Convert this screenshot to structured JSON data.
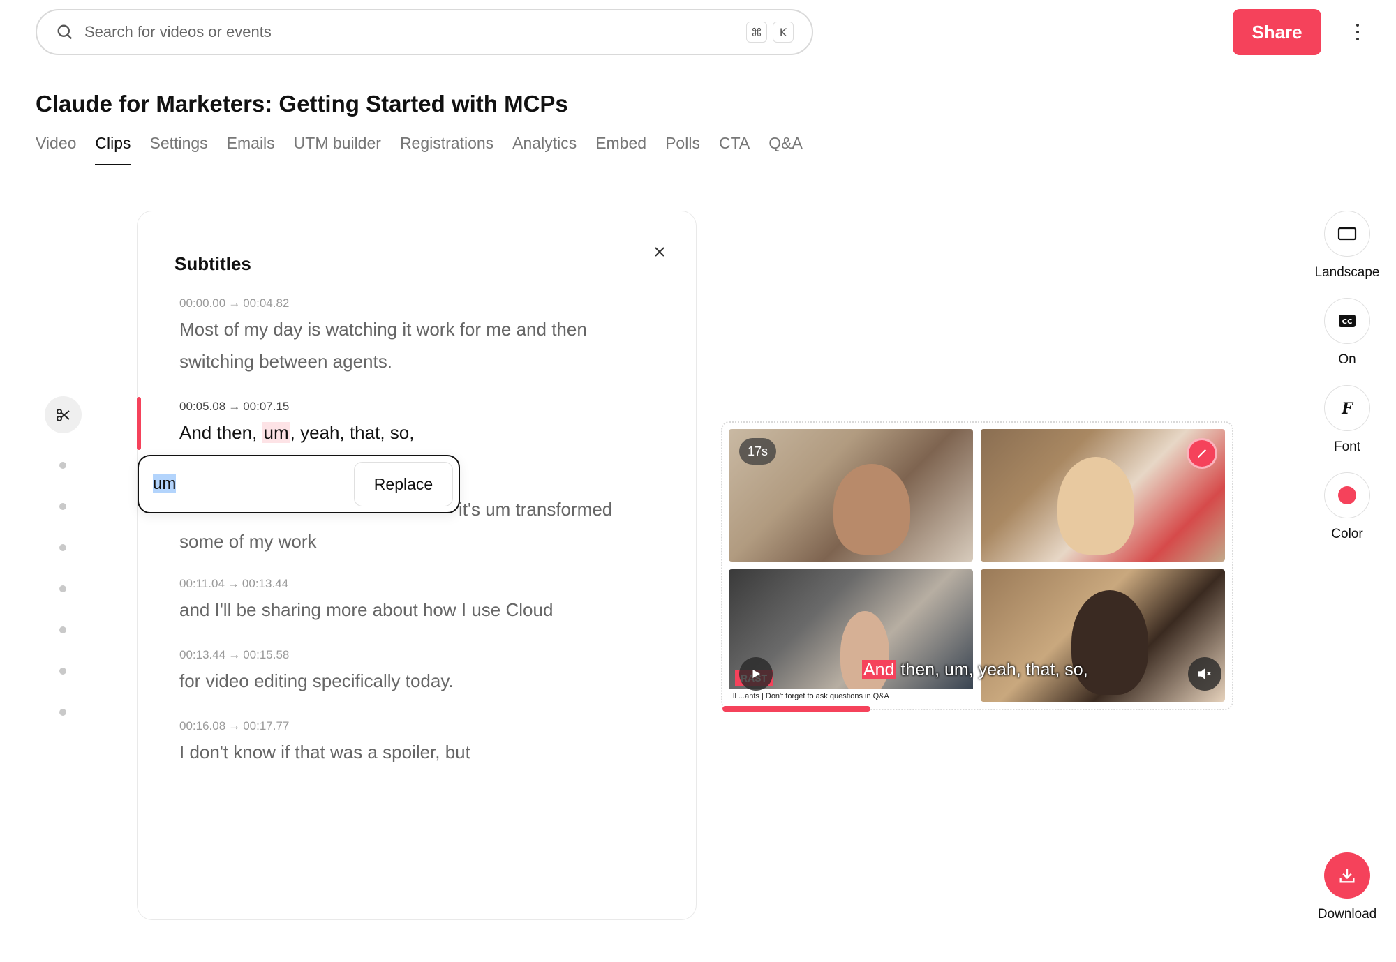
{
  "search": {
    "placeholder": "Search for videos or events",
    "shortcut_keys": [
      "⌘",
      "K"
    ]
  },
  "header": {
    "share_label": "Share"
  },
  "page": {
    "title": "Claude for Marketers: Getting Started with MCPs"
  },
  "tabs": [
    {
      "label": "Video"
    },
    {
      "label": "Clips",
      "active": true
    },
    {
      "label": "Settings"
    },
    {
      "label": "Emails"
    },
    {
      "label": "UTM builder"
    },
    {
      "label": "Registrations"
    },
    {
      "label": "Analytics"
    },
    {
      "label": "Embed"
    },
    {
      "label": "Polls"
    },
    {
      "label": "CTA"
    },
    {
      "label": "Q&A"
    }
  ],
  "subtitles": {
    "title": "Subtitles",
    "segments": [
      {
        "start": "00:00.00",
        "end": "00:04.82",
        "text": "Most of my day is watching it work for me and then switching between agents."
      },
      {
        "start": "00:05.08",
        "end": "00:07.15",
        "text_before": "And then, ",
        "highlight": "um",
        "text_after": ", yeah, that, so,",
        "active": true
      },
      {
        "partial_text": "it's um transformed",
        "text": "some of my work"
      },
      {
        "start": "00:11.04",
        "end": "00:13.44",
        "text": "and I'll be sharing more about how I use Cloud"
      },
      {
        "start": "00:13.44",
        "end": "00:15.58",
        "text": "for video editing specifically today."
      },
      {
        "start": "00:16.08",
        "end": "00:17.77",
        "text": "I don't know if that was a spoiler, but"
      }
    ],
    "replace_popup": {
      "word": "um",
      "button_label": "Replace"
    }
  },
  "preview": {
    "duration_badge": "17s",
    "caption_first": "And",
    "caption_rest": " then, um, yeah, that, so,",
    "ticker_tag": "RAST",
    "ticker_text": "ll ...ants | Don't forget to ask questions in Q&A",
    "progress_fraction": 0.29
  },
  "tools": [
    {
      "label": "Landscape",
      "icon": "landscape-icon"
    },
    {
      "label": "On",
      "icon": "cc-icon"
    },
    {
      "label": "Font",
      "icon": "font-icon"
    },
    {
      "label": "Color",
      "icon": "color-dot-icon"
    },
    {
      "label": "Download",
      "icon": "download-icon"
    }
  ],
  "colors": {
    "accent": "#f5425b",
    "highlight": "#fde3e6",
    "selection": "#b3d4fc"
  }
}
